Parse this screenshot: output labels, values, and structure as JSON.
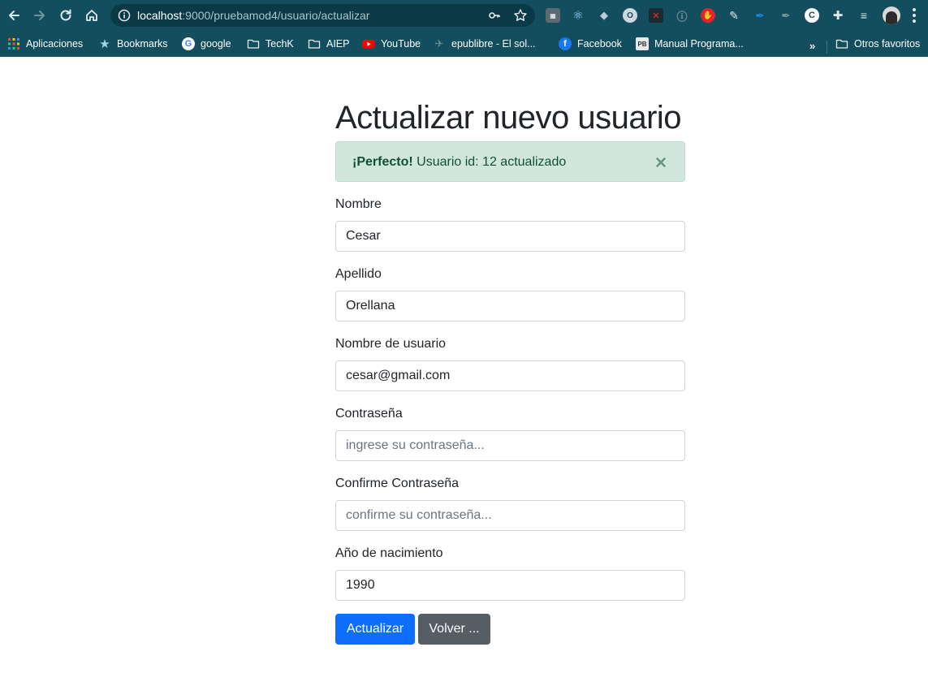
{
  "browser": {
    "url_host": "localhost",
    "url_path": ":9000/pruebamod4/usuario/actualizar",
    "bookmarks": [
      {
        "label": "Aplicaciones",
        "icon": "apps-grid-icon"
      },
      {
        "label": "Bookmarks",
        "icon": "star-icon"
      },
      {
        "label": "google",
        "icon": "google-icon"
      },
      {
        "label": "TechK",
        "icon": "folder-icon"
      },
      {
        "label": "AIEP",
        "icon": "folder-icon"
      },
      {
        "label": "YouTube",
        "icon": "youtube-icon"
      },
      {
        "label": "epublibre - El sol...",
        "icon": "epublibre-icon"
      },
      {
        "label": "Facebook",
        "icon": "facebook-icon"
      },
      {
        "label": "Manual Programa...",
        "icon": "pb-icon"
      },
      {
        "label": "Otros favoritos",
        "icon": "folder-icon"
      }
    ],
    "more_label": "»",
    "colors": {
      "chrome": "#124e5e",
      "omnibox": "#0b3a47"
    }
  },
  "page": {
    "title": "Actualizar nuevo usuario",
    "alert": {
      "strong": "¡Perfecto!",
      "text": " Usuario id: 12 actualizado"
    },
    "form": {
      "nombre": {
        "label": "Nombre",
        "value": "Cesar"
      },
      "apellido": {
        "label": "Apellido",
        "value": "Orellana"
      },
      "usuario": {
        "label": "Nombre de usuario",
        "value": "cesar@gmail.com"
      },
      "password": {
        "label": "Contraseña",
        "placeholder": "ingrese su contraseña..."
      },
      "confirm": {
        "label": "Confirme Contraseña",
        "placeholder": "confirme su contraseña..."
      },
      "anio": {
        "label": "Año de nacimiento",
        "value": "1990"
      }
    },
    "buttons": {
      "submit": "Actualizar",
      "back": "Volver ..."
    },
    "colors": {
      "primary": "#0d6efd",
      "secondary": "#565e64",
      "success_bg": "#d1e7dd",
      "success_text": "#0f5132"
    }
  }
}
